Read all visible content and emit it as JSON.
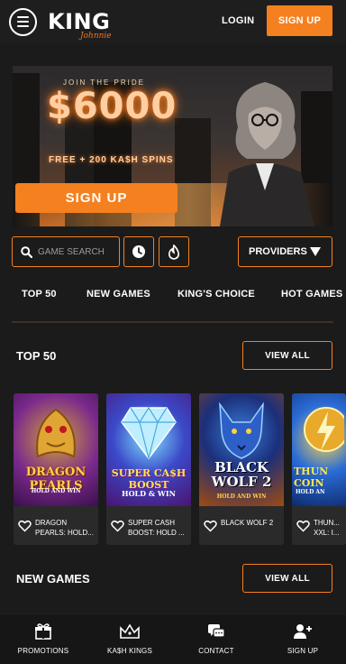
{
  "header": {
    "logo_main": "KING",
    "logo_sub": "Johnnie",
    "login_label": "LOGIN",
    "signup_label": "SIGN UP"
  },
  "banner": {
    "tagline": "JOIN THE PRIDE",
    "amount": "$6000",
    "spins": "FREE + 200 KA$H SPINS",
    "signup_label": "SIGN UP"
  },
  "search": {
    "placeholder": "GAME SEARCH",
    "providers_label": "PROVIDERS"
  },
  "categories": [
    "TOP 50",
    "NEW GAMES",
    "KING'S CHOICE",
    "HOT GAMES"
  ],
  "sections": {
    "top50": {
      "title": "TOP 50",
      "view_all": "VIEW ALL"
    },
    "new_games": {
      "title": "NEW GAMES",
      "view_all": "VIEW ALL"
    }
  },
  "games": [
    {
      "name": "DRAGON PEARLS: HOLD...",
      "thumb_title": "DRAGON PEARLS",
      "thumb_sub": "HOLD AND WIN"
    },
    {
      "name": "SUPER CASH BOOST: HOLD ...",
      "thumb_title": "SUPER CA$H BOOST",
      "thumb_sub": "HOLD & WIN"
    },
    {
      "name": "BLACK WOLF 2",
      "thumb_title": "BLACK WOLF 2",
      "thumb_sub": "HOLD AND WIN"
    },
    {
      "name": "THUN... XXL: I...",
      "thumb_title": "THUN COIN",
      "thumb_sub": "HOLD AN"
    }
  ],
  "bottom_nav": [
    {
      "label": "PROMOTIONS",
      "icon": "gift-icon"
    },
    {
      "label": "KA$H KINGS",
      "icon": "crown-icon"
    },
    {
      "label": "CONTACT",
      "icon": "chat-icon"
    },
    {
      "label": "SIGN UP",
      "icon": "add-user-icon"
    }
  ],
  "colors": {
    "accent": "#f5801f",
    "background": "#1b1b1b"
  }
}
